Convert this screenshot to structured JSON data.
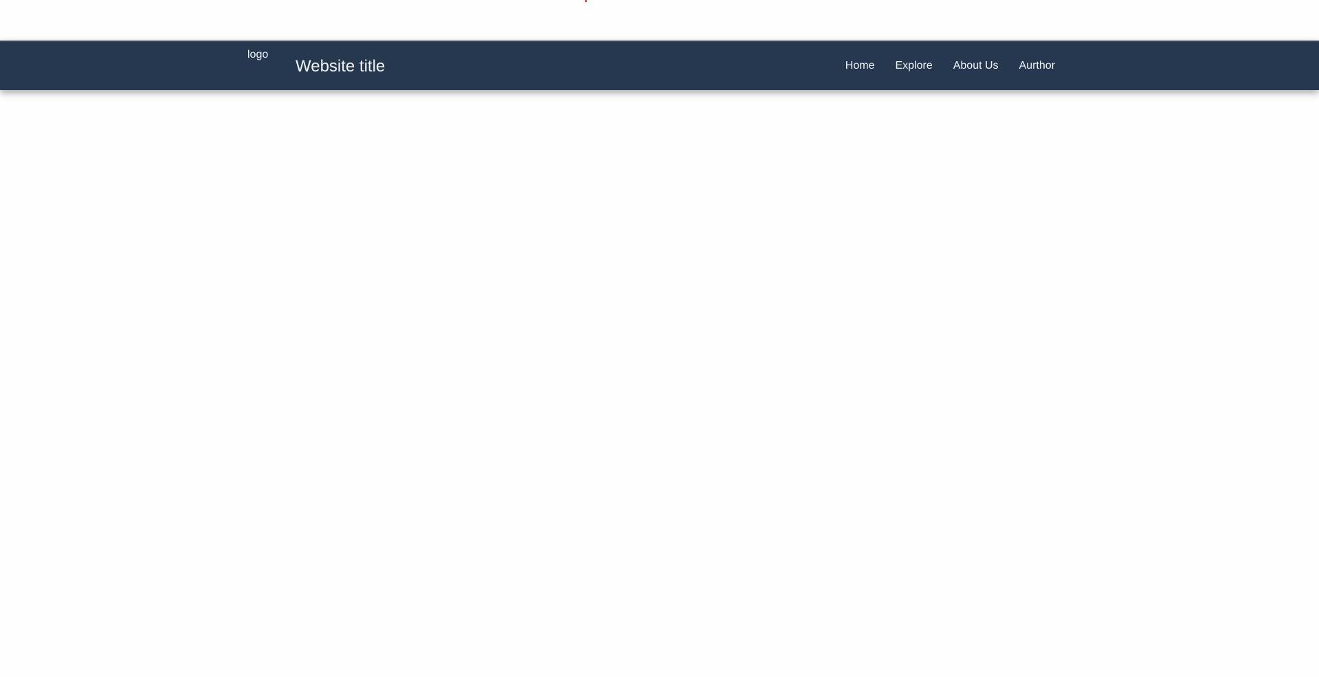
{
  "colors": {
    "page_background": "#fefefe",
    "navbar_background": "#263850",
    "navbar_text": "#f1f4f7",
    "marker": "#d11a1a"
  },
  "header": {
    "logo_alt": "logo",
    "title": "Website title"
  },
  "nav": {
    "items": [
      {
        "label": "Home"
      },
      {
        "label": "Explore"
      },
      {
        "label": "About Us"
      },
      {
        "label": "Aurthor"
      }
    ]
  }
}
